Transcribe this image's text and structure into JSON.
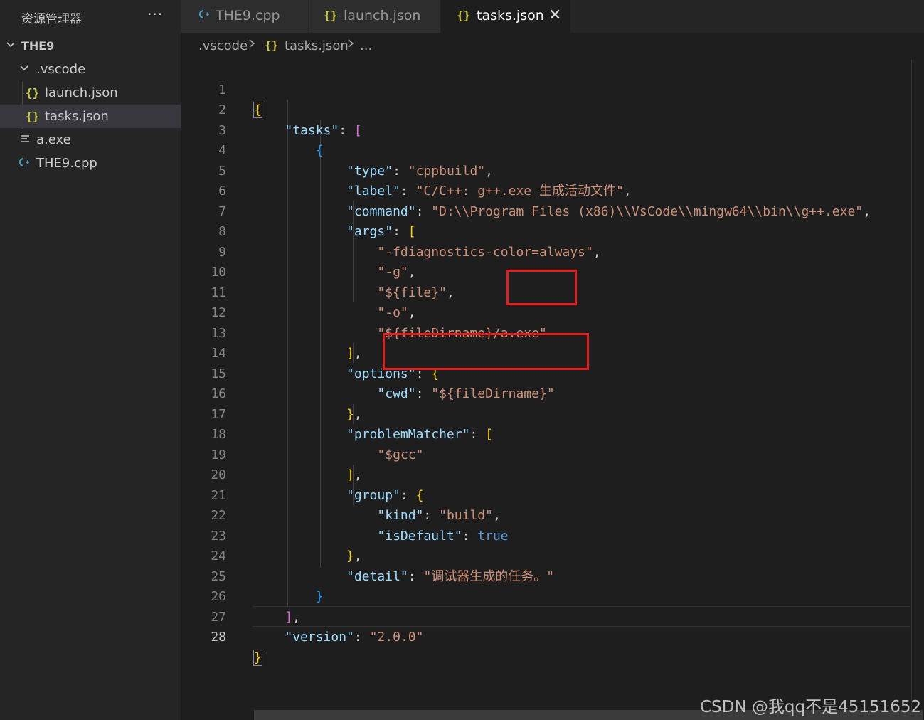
{
  "sidebar": {
    "title": "资源管理器",
    "more": "···",
    "root_folder": "THE9",
    "items": [
      {
        "label": ".vscode",
        "type": "folder"
      },
      {
        "label": "launch.json",
        "type": "json"
      },
      {
        "label": "tasks.json",
        "type": "json",
        "selected": true
      },
      {
        "label": "a.exe",
        "type": "exe"
      },
      {
        "label": "THE9.cpp",
        "type": "cpp"
      }
    ]
  },
  "tabs": [
    {
      "label": "THE9.cpp",
      "icon": "cpp-file-icon",
      "active": false
    },
    {
      "label": "launch.json",
      "icon": "json-braces-icon",
      "active": false
    },
    {
      "label": "tasks.json",
      "icon": "json-braces-icon",
      "active": true,
      "close": "✕"
    }
  ],
  "breadcrumb": {
    "folder": ".vscode",
    "file": "tasks.json",
    "tail": "..."
  },
  "editor": {
    "current_line": 28,
    "lines": [
      {
        "n": "1"
      },
      {
        "n": "2"
      },
      {
        "n": "3"
      },
      {
        "n": "4"
      },
      {
        "n": "5"
      },
      {
        "n": "6"
      },
      {
        "n": "7"
      },
      {
        "n": "8"
      },
      {
        "n": "9"
      },
      {
        "n": "10"
      },
      {
        "n": "11"
      },
      {
        "n": "12"
      },
      {
        "n": "13"
      },
      {
        "n": "14"
      },
      {
        "n": "15"
      },
      {
        "n": "16"
      },
      {
        "n": "17"
      },
      {
        "n": "18"
      },
      {
        "n": "19"
      },
      {
        "n": "20"
      },
      {
        "n": "21"
      },
      {
        "n": "22"
      },
      {
        "n": "23"
      },
      {
        "n": "24"
      },
      {
        "n": "25"
      },
      {
        "n": "26"
      },
      {
        "n": "27"
      },
      {
        "n": "28"
      }
    ],
    "code": {
      "l1_open": "{",
      "l2_key": "\"tasks\"",
      "l2_open": "[",
      "l3_open": "{",
      "l4_key": "\"type\"",
      "l4_val": "\"cppbuild\"",
      "l5_key": "\"label\"",
      "l5_val": "\"C/C++: g++.exe 生成活动文件\"",
      "l6_key": "\"command\"",
      "l6_val": "\"D:\\\\Program Files (x86)\\\\VsCode\\\\mingw64\\\\bin\\\\g++.exe\"",
      "l7_key": "\"args\"",
      "l7_open": "[",
      "l8_val": "\"-fdiagnostics-color=always\"",
      "l9_val": "\"-g\"",
      "l10_val": "\"${file}\"",
      "l11_val": "\"-o\"",
      "l12_val": "\"${fileDirname}/a.exe\"",
      "l13_close": "]",
      "l14_key": "\"options\"",
      "l14_open": "{",
      "l15_key": "\"cwd\"",
      "l15_val": "\"${fileDirname}\"",
      "l16_close": "}",
      "l17_key": "\"problemMatcher\"",
      "l17_open": "[",
      "l18_val": "\"$gcc\"",
      "l19_close": "]",
      "l20_key": "\"group\"",
      "l20_open": "{",
      "l21_key": "\"kind\"",
      "l21_val": "\"build\"",
      "l22_key": "\"isDefault\"",
      "l22_val": "true",
      "l23_close": "}",
      "l24_key": "\"detail\"",
      "l24_val": "\"调试器生成的任务。\"",
      "l25_close": "}",
      "l26_close": "]",
      "l27_key": "\"version\"",
      "l27_val": "\"2.0.0\"",
      "l28_close": "}"
    }
  },
  "watermark": "CSDN @我qq不是45151652",
  "colors": {
    "annotation_box": "#e51c1c",
    "json_icon": "#cbcb41",
    "cpp_icon": "#519aba"
  }
}
